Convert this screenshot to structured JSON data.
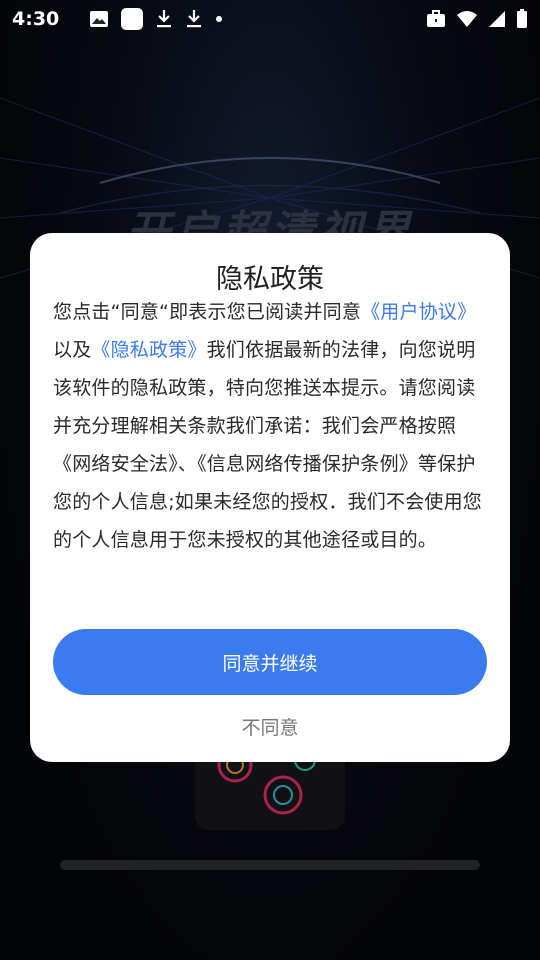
{
  "status_bar": {
    "time": "4:30",
    "left_icons": [
      "image-icon",
      "app-icon",
      "download-icon",
      "download-icon",
      "dot-icon"
    ],
    "right_icons": [
      "briefcase-icon",
      "wifi-icon",
      "signal-icon",
      "battery-icon"
    ]
  },
  "background": {
    "title": "开启超清视界"
  },
  "dialog": {
    "title": "隐私政策",
    "body": {
      "part1": "您点击“同意“即表示您已阅读并同意",
      "link_user_agreement": "《用户协议》",
      "part2": "以及",
      "link_privacy_policy": "《隐私政策》",
      "part3": "我们依据最新的法律，向您说明该软件的隐私政策，特向您推送本提示。请您阅读并充分理解相关条款我们承诺：我们会严格按照《网络安全法》、《信息网络传播保护条例》等保护您的个人信息;如果未经您的授权．我们不会使用您的个人信息用于您未授权的其他途径或目的。"
    },
    "agree_button": "同意并继续",
    "disagree_button": "不同意"
  },
  "colors": {
    "accent": "#3b7bf0",
    "dialog_bg": "#ffffff",
    "screen_bg": "#050609"
  }
}
